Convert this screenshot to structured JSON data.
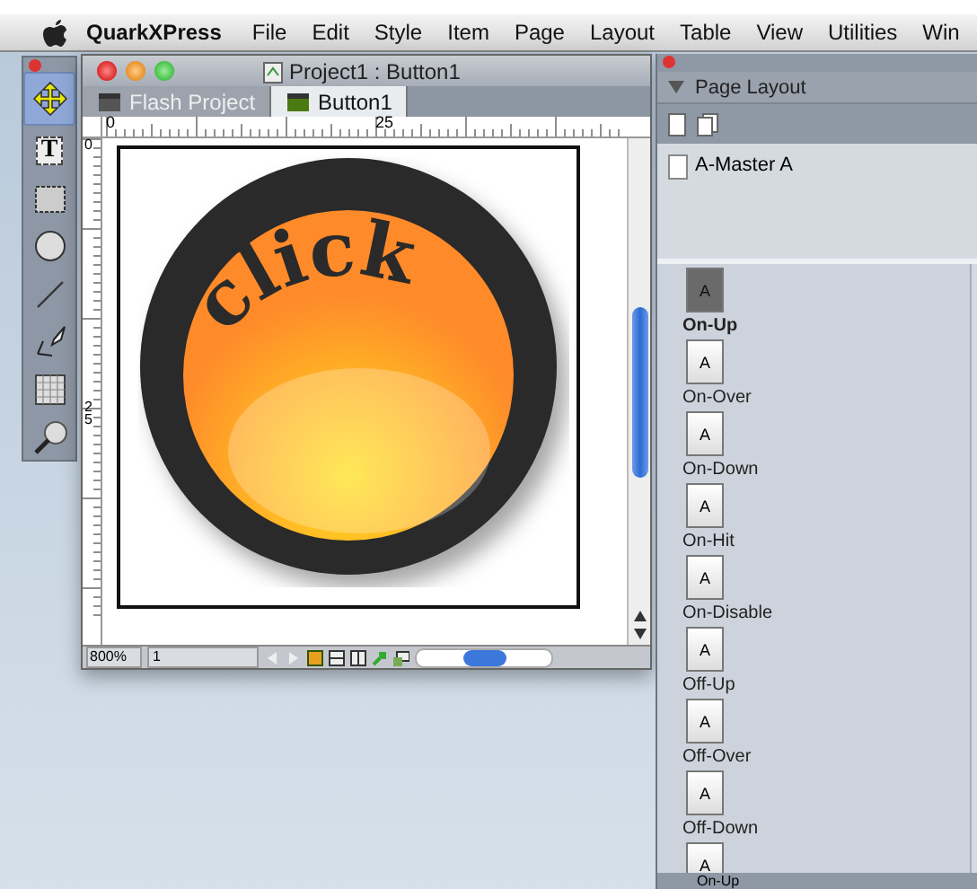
{
  "menu_bar": {
    "app": "QuarkXPress",
    "items": [
      "File",
      "Edit",
      "Style",
      "Item",
      "Page",
      "Layout",
      "Table",
      "View",
      "Utilities",
      "Win"
    ]
  },
  "tools": [
    {
      "kind": "move",
      "selected": true
    },
    {
      "kind": "text",
      "label": "T",
      "selected": false
    },
    {
      "kind": "picture",
      "selected": false
    },
    {
      "kind": "oval",
      "selected": false
    },
    {
      "kind": "line",
      "selected": false
    },
    {
      "kind": "pen",
      "selected": false
    },
    {
      "kind": "table",
      "selected": false
    },
    {
      "kind": "zoom",
      "selected": false
    }
  ],
  "document": {
    "title": "Project1 : Button1",
    "tabs": [
      {
        "label": "Flash Project",
        "selected": false
      },
      {
        "label": "Button1",
        "selected": true
      }
    ],
    "h_ruler": [
      "0",
      "25"
    ],
    "v_ruler": [
      "0",
      "25"
    ],
    "artwork_text": "click",
    "zoom": "800%",
    "page": "1"
  },
  "page_layout": {
    "title": "Page Layout",
    "master": "A-Master A",
    "pages": [
      {
        "thumb": "A",
        "label": "On-Up",
        "selected": true
      },
      {
        "thumb": "A",
        "label": "On-Over",
        "selected": false
      },
      {
        "thumb": "A",
        "label": "On-Down",
        "selected": false
      },
      {
        "thumb": "A",
        "label": "On-Hit",
        "selected": false
      },
      {
        "thumb": "A",
        "label": "On-Disable",
        "selected": false
      },
      {
        "thumb": "A",
        "label": "Off-Up",
        "selected": false
      },
      {
        "thumb": "A",
        "label": "Off-Over",
        "selected": false
      },
      {
        "thumb": "A",
        "label": "Off-Down",
        "selected": false
      },
      {
        "thumb": "A",
        "selected": false
      }
    ],
    "footer": "On-Up"
  }
}
